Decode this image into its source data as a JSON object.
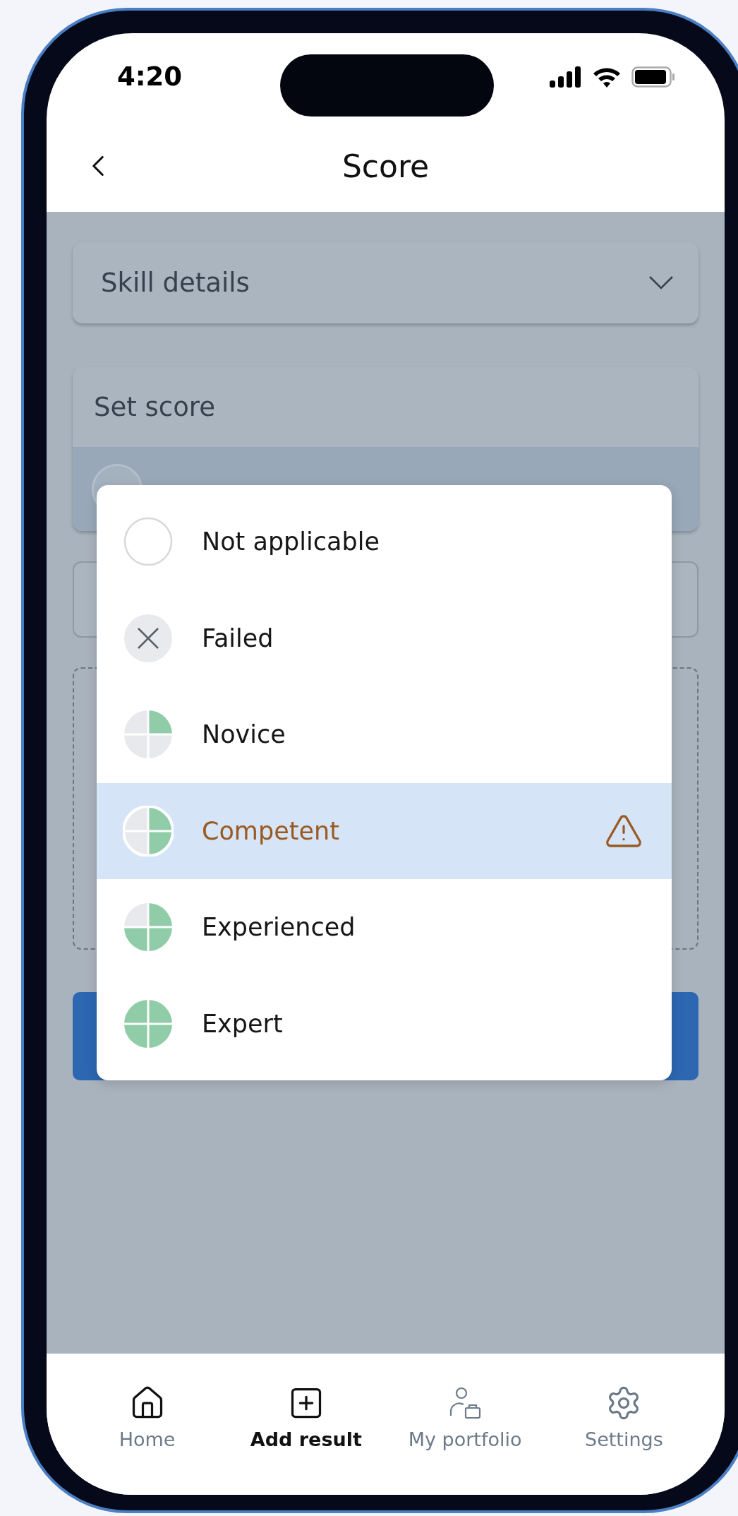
{
  "status_bar": {
    "time": "4:20"
  },
  "header": {
    "title": "Score"
  },
  "skill_details": {
    "title": "Skill details",
    "expanded": false
  },
  "set_score": {
    "title": "Set score"
  },
  "score_menu": {
    "items": [
      {
        "label": "Not applicable",
        "kind": "none",
        "selected": false,
        "warning": false
      },
      {
        "label": "Failed",
        "kind": "failed",
        "selected": false,
        "warning": false
      },
      {
        "label": "Novice",
        "kind": "quarter",
        "selected": false,
        "warning": false
      },
      {
        "label": "Competent",
        "kind": "half",
        "selected": true,
        "warning": true
      },
      {
        "label": "Experienced",
        "kind": "threequarter",
        "selected": false,
        "warning": false
      },
      {
        "label": "Expert",
        "kind": "full",
        "selected": false,
        "warning": false
      }
    ]
  },
  "tab_bar": [
    {
      "label": "Home",
      "kind": "home",
      "selected": false
    },
    {
      "label": "Add result",
      "kind": "add",
      "selected": true
    },
    {
      "label": "My portfolio",
      "kind": "portfolio",
      "selected": false
    },
    {
      "label": "Settings",
      "kind": "settings",
      "selected": false
    }
  ]
}
